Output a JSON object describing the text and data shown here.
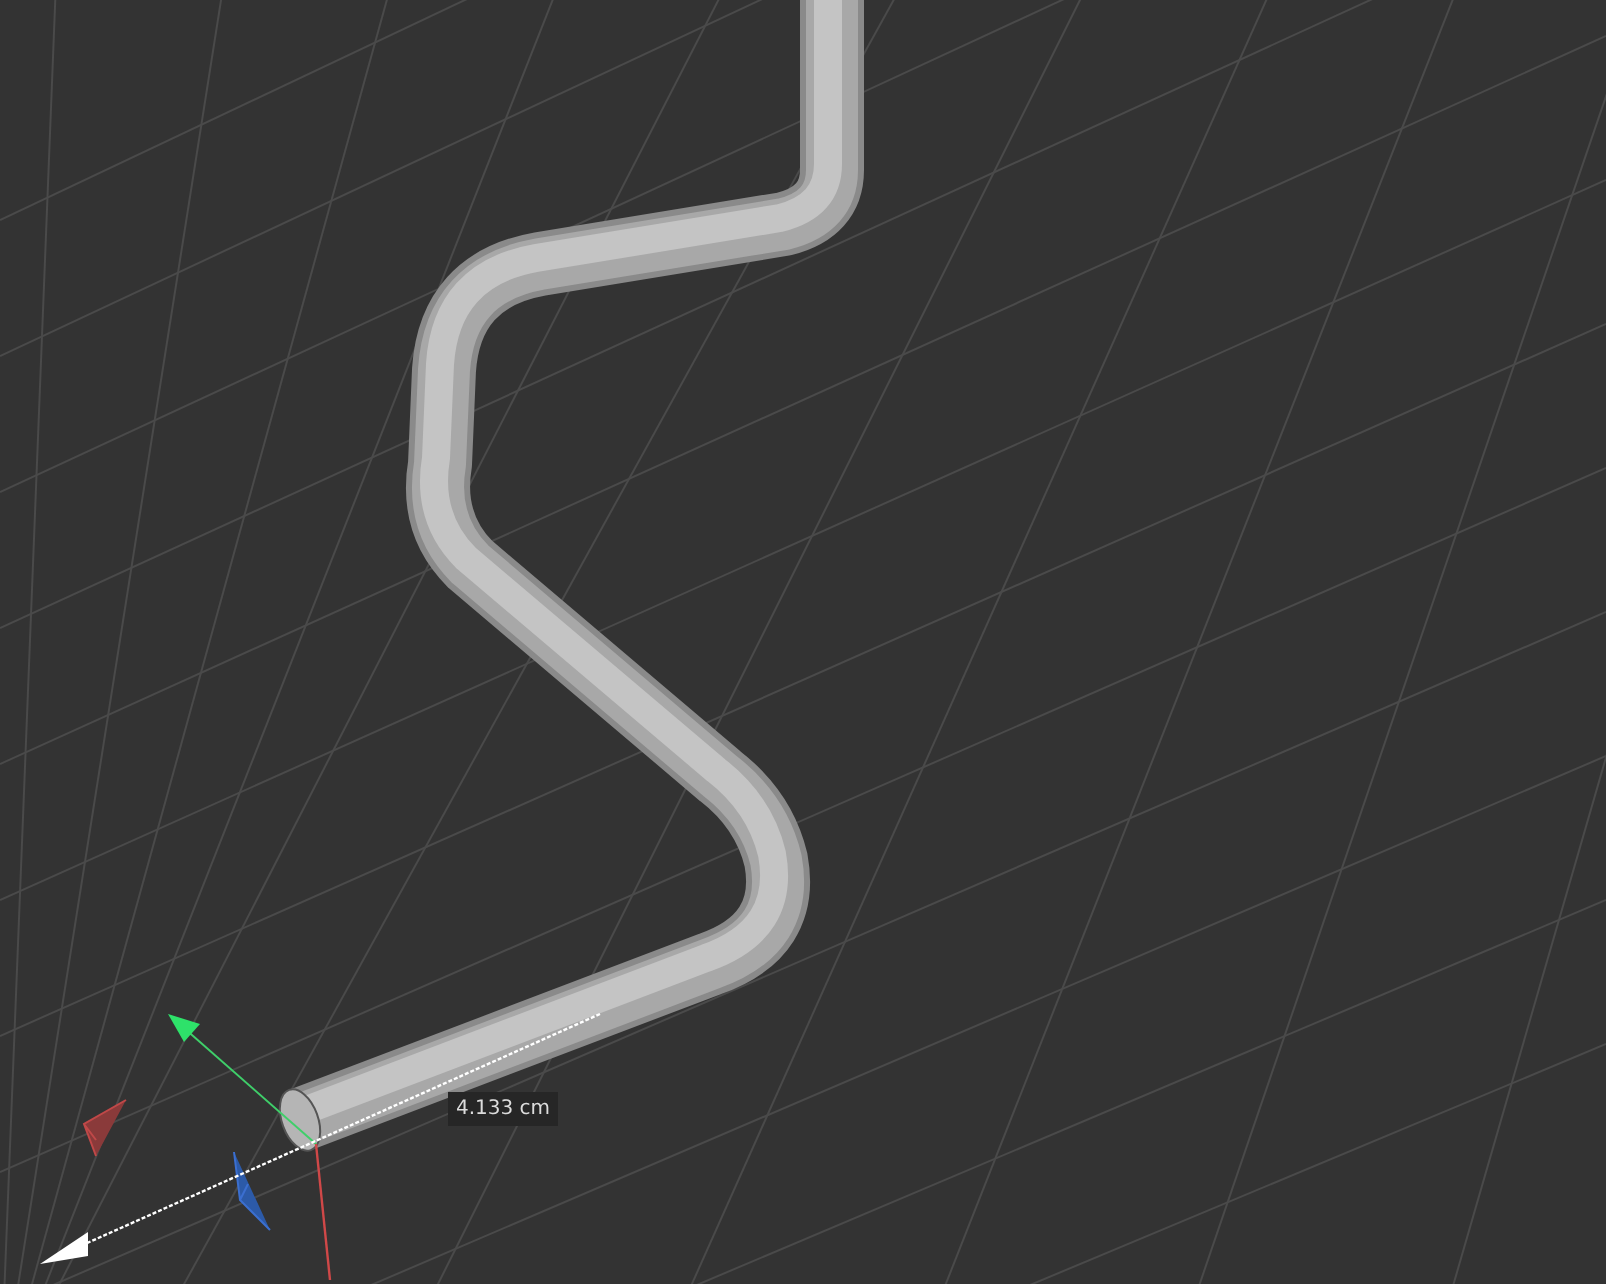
{
  "viewport": {
    "measure_label": "4.133 cm"
  }
}
